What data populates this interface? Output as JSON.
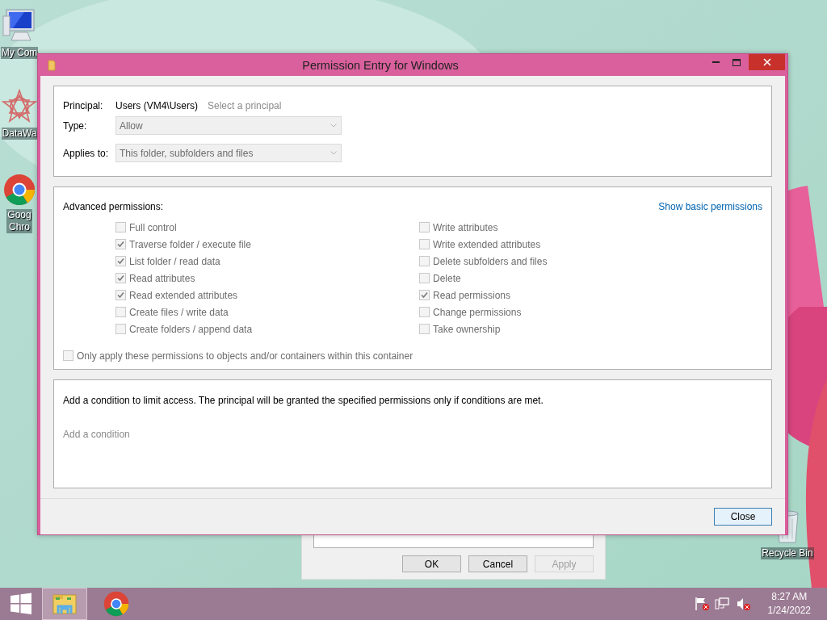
{
  "desktop_icons": [
    {
      "kind": "computer",
      "label_lines": [
        "My Com"
      ]
    },
    {
      "kind": "star",
      "label_lines": [
        "DataWa"
      ]
    },
    {
      "kind": "chrome",
      "label_lines": [
        "Goog",
        "Chro"
      ]
    },
    {
      "kind": "recycle",
      "label_lines": [
        "Recycle Bin"
      ]
    }
  ],
  "background_window": {
    "buttons": [
      {
        "label": "OK",
        "disabled": false
      },
      {
        "label": "Cancel",
        "disabled": false
      },
      {
        "label": "Apply",
        "disabled": true
      }
    ]
  },
  "dialog": {
    "title": "Permission Entry for Windows",
    "principal": {
      "label": "Principal:",
      "value": "Users (VM4\\Users)",
      "link": "Select a principal",
      "link_disabled": true
    },
    "type": {
      "label": "Type:",
      "value": "Allow",
      "disabled": true
    },
    "applies_to": {
      "label": "Applies to:",
      "value": "This folder, subfolders and files",
      "disabled": true
    },
    "advanced": {
      "heading": "Advanced permissions:",
      "link": "Show basic permissions",
      "link_disabled": false,
      "left": [
        {
          "label": "Full control",
          "checked": false,
          "disabled": true
        },
        {
          "label": "Traverse folder / execute file",
          "checked": true,
          "disabled": true
        },
        {
          "label": "List folder / read data",
          "checked": true,
          "disabled": true
        },
        {
          "label": "Read attributes",
          "checked": true,
          "disabled": true
        },
        {
          "label": "Read extended attributes",
          "checked": true,
          "disabled": true
        },
        {
          "label": "Create files / write data",
          "checked": false,
          "disabled": true
        },
        {
          "label": "Create folders / append data",
          "checked": false,
          "disabled": true
        }
      ],
      "right": [
        {
          "label": "Write attributes",
          "checked": false,
          "disabled": true
        },
        {
          "label": "Write extended attributes",
          "checked": false,
          "disabled": true
        },
        {
          "label": "Delete subfolders and files",
          "checked": false,
          "disabled": true
        },
        {
          "label": "Delete",
          "checked": false,
          "disabled": true
        },
        {
          "label": "Read permissions",
          "checked": true,
          "disabled": true
        },
        {
          "label": "Change permissions",
          "checked": false,
          "disabled": true
        },
        {
          "label": "Take ownership",
          "checked": false,
          "disabled": true
        }
      ],
      "only_apply": {
        "label": "Only apply these permissions to objects and/or containers within this container",
        "checked": false,
        "disabled": true
      }
    },
    "condition": {
      "text": "Add a condition to limit access. The principal will be granted the specified permissions only if conditions are met.",
      "link": "Add a condition",
      "link_disabled": true
    },
    "buttons": [
      {
        "label": "Close",
        "disabled": false
      }
    ]
  },
  "taskbar": {
    "apps": [
      {
        "kind": "explorer",
        "selected": true
      },
      {
        "kind": "chrome",
        "selected": false
      }
    ],
    "tray": {
      "time": "8:27 AM",
      "date": "1/24/2022"
    }
  }
}
